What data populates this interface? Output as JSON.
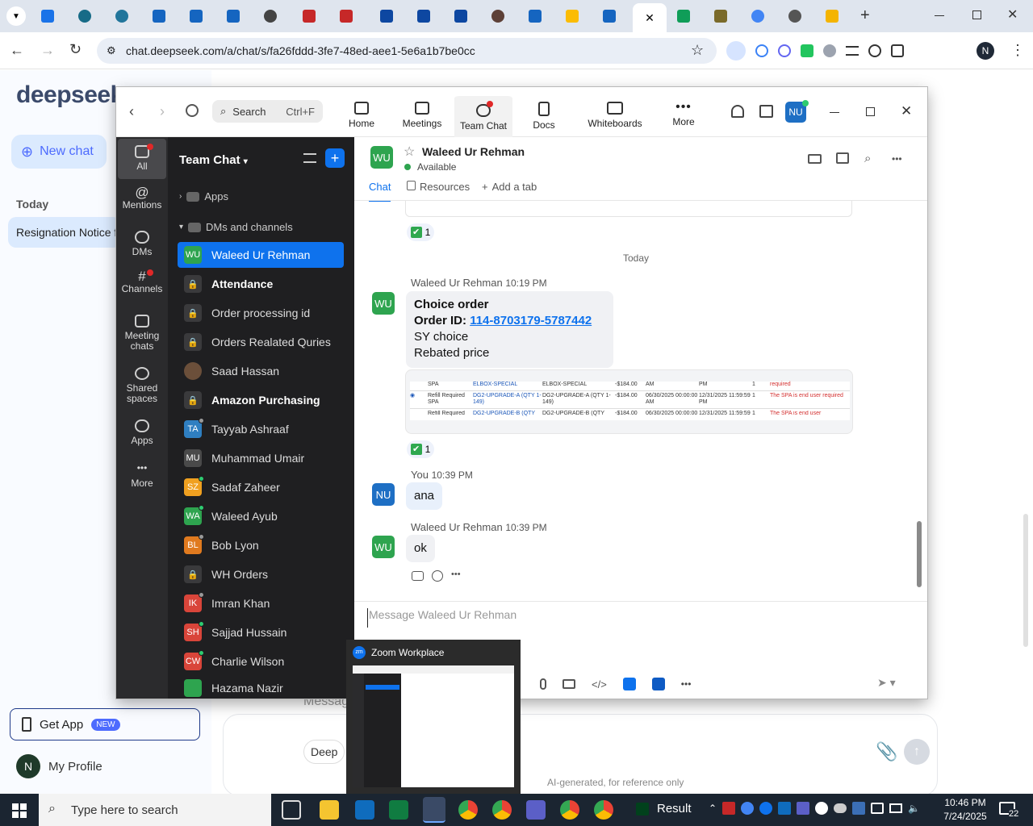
{
  "browser": {
    "url": "chat.deepseek.com/a/chat/s/fa26fddd-3fe7-48ed-aee1-5e6a1b7be0cc",
    "profile_initial": "N",
    "close_tab": "✕",
    "new_tab": "+"
  },
  "deepseek": {
    "logo": "deepseek",
    "new_chat": "New chat",
    "section_today": "Today",
    "history_item": "Resignation Notice f",
    "get_app": "Get App",
    "new_badge": "NEW",
    "my_profile": "My Profile",
    "profile_initial": "N",
    "input_placeholder": "Messag",
    "tool_label": "Deep",
    "footer_note": "AI-generated, for reference only"
  },
  "zoom": {
    "search_placeholder": "Search",
    "search_shortcut": "Ctrl+F",
    "nav": [
      {
        "label": "Home"
      },
      {
        "label": "Meetings"
      },
      {
        "label": "Team Chat"
      },
      {
        "label": "Docs"
      },
      {
        "label": "Whiteboards"
      },
      {
        "label": "More"
      }
    ],
    "user_avatar": "NU",
    "rail": [
      {
        "label": "All"
      },
      {
        "label": "Mentions"
      },
      {
        "label": "DMs"
      },
      {
        "label": "Channels"
      },
      {
        "label": "Meeting chats"
      },
      {
        "label": "Shared spaces"
      },
      {
        "label": "Apps"
      },
      {
        "label": "More"
      }
    ],
    "list_title": "Team Chat",
    "group_apps": "Apps",
    "group_dms": "DMs and channels",
    "contacts": [
      {
        "initials": "WU",
        "name": "Waleed Ur Rehman",
        "color": "#2ea44f"
      },
      {
        "initials": "",
        "name": "Attendance",
        "color": "#3a3a3c"
      },
      {
        "initials": "",
        "name": "Order processing id",
        "color": "#3a3a3c"
      },
      {
        "initials": "",
        "name": "Orders Realated Quries",
        "color": "#3a3a3c"
      },
      {
        "initials": "",
        "name": "Saad Hassan",
        "color": "#6b4f3a"
      },
      {
        "initials": "",
        "name": "Amazon Purchasing",
        "color": "#3a3a3c"
      },
      {
        "initials": "TA",
        "name": "Tayyab Ashraaf",
        "color": "#2f7fc1"
      },
      {
        "initials": "MU",
        "name": "Muhammad Umair",
        "color": "#4a4a4a"
      },
      {
        "initials": "SZ",
        "name": "Sadaf Zaheer",
        "color": "#f0a020"
      },
      {
        "initials": "WA",
        "name": "Waleed Ayub",
        "color": "#2ea44f"
      },
      {
        "initials": "BL",
        "name": "Bob Lyon",
        "color": "#e07a1f"
      },
      {
        "initials": "",
        "name": "WH Orders",
        "color": "#3a3a3c"
      },
      {
        "initials": "IK",
        "name": "Imran Khan",
        "color": "#d9453a"
      },
      {
        "initials": "SH",
        "name": "Sajjad Hussain",
        "color": "#d9453a"
      },
      {
        "initials": "CW",
        "name": "Charlie Wilson",
        "color": "#d9453a"
      },
      {
        "initials": "",
        "name": "Hazama Nazir",
        "color": "#2ea44f"
      }
    ],
    "chat": {
      "header_initials": "WU",
      "header_name": "Waleed Ur Rehman",
      "status": "Available",
      "tabs": [
        {
          "label": "Chat"
        },
        {
          "label": "Resources"
        },
        {
          "label": "Add a tab"
        }
      ],
      "reaction_count": "1",
      "day_separator": "Today",
      "msg1_name": "Waleed Ur Rehman",
      "msg1_time": "10:19 PM",
      "msg1_title": "Choice order",
      "msg1_order_label": "Order ID: ",
      "msg1_order_id": "114-8703179-5787442",
      "msg1_line3": "SY choice",
      "msg1_line4": "Rebated price",
      "table_rows": [
        {
          "c1": "SPA",
          "c2": "ELBOX-SPECIAL",
          "c3": "ELBOX-SPECIAL",
          "c4": "-$184.00",
          "c5": "AM",
          "c6": "PM",
          "c7": "1",
          "c8": "required"
        },
        {
          "c1": "Refill Required SPA",
          "c2": "DG2-UPGRADE-A (QTY 1-149)",
          "c3": "DG2-UPGRADE-A (QTY 1-149)",
          "c4": "-$184.00",
          "c5": "06/30/2025 00:00:00 AM",
          "c6": "12/31/2025 11:59:59 PM",
          "c7": "1",
          "c8": "The SPA is end user required"
        },
        {
          "c1": "Refill Required",
          "c2": "DG2-UPGRADE-B (QTY",
          "c3": "DG2-UPGRADE-B (QTY",
          "c4": "-$184.00",
          "c5": "06/30/2025 00:00:00",
          "c6": "12/31/2025 11:59:59",
          "c7": "1",
          "c8": "The SPA is end user"
        }
      ],
      "msg2_name": "You",
      "msg2_time": "10:39 PM",
      "msg2_initials": "NU",
      "msg2_text": "ana",
      "msg3_name": "Waleed Ur Rehman",
      "msg3_time": "10:39 PM",
      "msg3_text": "ok",
      "input_placeholder": "Message Waleed Ur Rehman"
    }
  },
  "thumbnail": {
    "title": "Zoom Workplace"
  },
  "taskbar": {
    "search_placeholder": "Type here to search",
    "result_label": "Result",
    "time": "10:46 PM",
    "date": "7/24/2025",
    "notif_count": "22"
  }
}
